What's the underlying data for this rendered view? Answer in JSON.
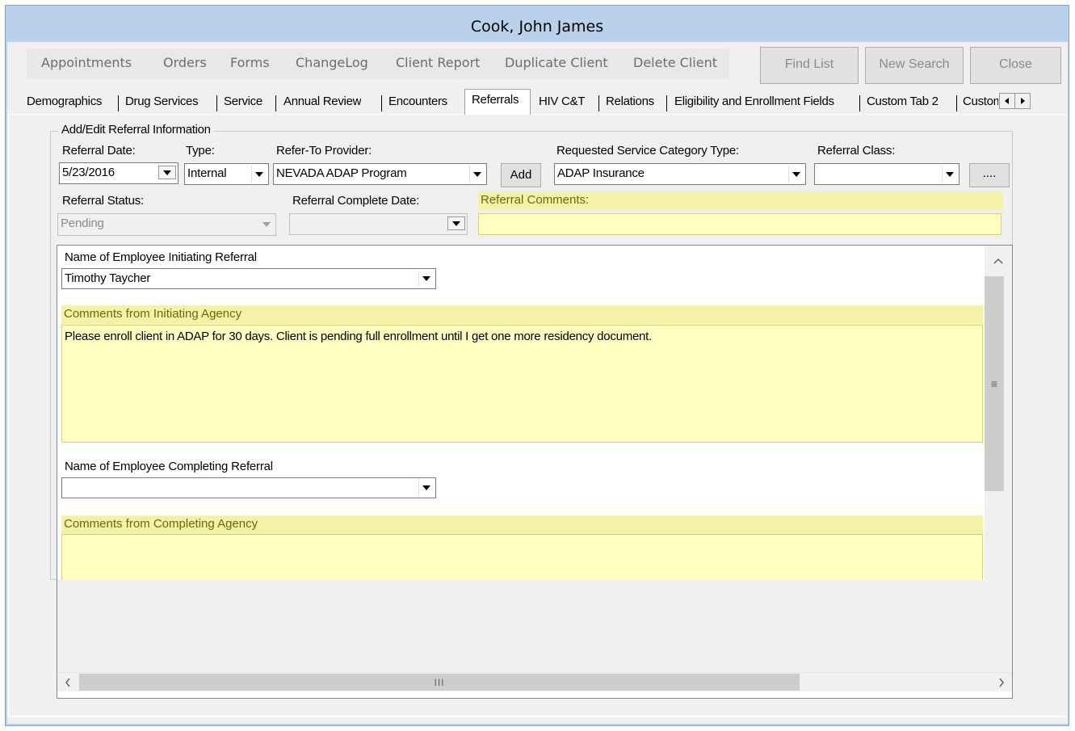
{
  "window": {
    "title": "Cook, John James"
  },
  "menu": {
    "items": [
      "Appointments",
      "Orders",
      "Forms",
      "ChangeLog",
      "Client Report",
      "Duplicate Client",
      "Delete Client"
    ]
  },
  "toolbar": {
    "find_list": "Find List",
    "new_search": "New Search",
    "close": "Close"
  },
  "tabs": {
    "items": [
      "Demographics",
      "Drug Services",
      "Service",
      "Annual Review",
      "Encounters",
      "Referrals",
      "HIV C&T",
      "Relations",
      "Eligibility and Enrollment Fields",
      "Custom Tab 2",
      "Custom Ta"
    ],
    "active": "Referrals"
  },
  "referral": {
    "group_title": "Add/Edit Referral Information",
    "date_label": "Referral Date:",
    "date_value": "5/23/2016",
    "type_label": "Type:",
    "type_value": "Internal",
    "provider_label": "Refer-To Provider:",
    "provider_value": "NEVADA ADAP Program",
    "add_button": "Add",
    "category_label": "Requested Service Category Type:",
    "category_value": "ADAP Insurance",
    "class_label": "Referral Class:",
    "class_value": "",
    "more_button": "....",
    "status_label": "Referral Status:",
    "status_value": "Pending",
    "complete_date_label": "Referral Complete Date:",
    "complete_date_value": "",
    "comments_label": "Referral Comments:",
    "comments_value": ""
  },
  "detail": {
    "initiating_employee_label": "Name of Employee Initiating Referral",
    "initiating_employee_value": "Timothy Taycher",
    "initiating_comments_label": "Comments from Initiating Agency",
    "initiating_comments_value": "Please enroll client in ADAP for 30 days. Client is pending full enrollment until I get one more residency document.",
    "completing_employee_label": "Name of Employee Completing Referral",
    "completing_employee_value": "",
    "completing_comments_label": "Comments from Completing Agency",
    "completing_comments_value": ""
  },
  "scroll": {
    "hthumb_grip": "III",
    "vthumb_grip": "≡"
  },
  "colors": {
    "titlebar": "#b9d1ea",
    "yellow_field": "#ffffc0",
    "yellow_label": "#f4f2a8"
  }
}
